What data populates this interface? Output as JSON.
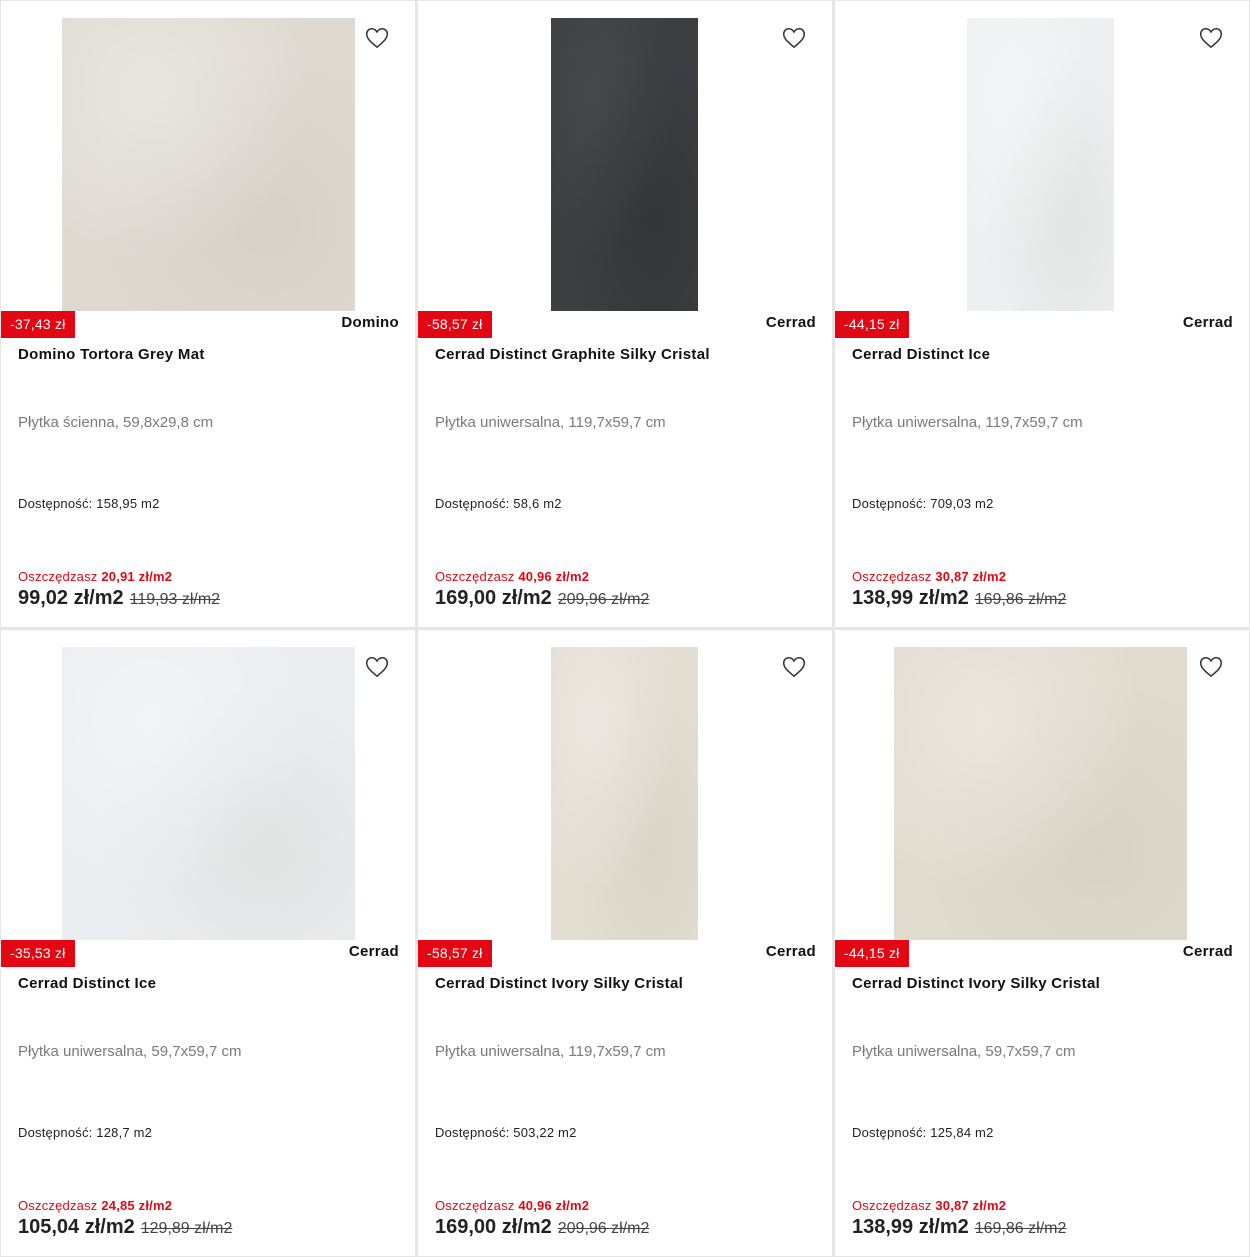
{
  "products": [
    {
      "badge": "-37,43 zł",
      "brand": "Domino",
      "name": "Domino Tortora Grey Mat",
      "description": "Płytka ścienna, 59,8x29,8 cm",
      "availability_label": "Dostępność:",
      "availability_value": "158,95 m2",
      "savings_label": "Oszczędzasz",
      "savings_value": "20,91 zł/m2",
      "price": "99,02 zł/m2",
      "old_price": "119,93 zł/m2",
      "tile_color": "#dedad2",
      "tile_shape": "square"
    },
    {
      "badge": "-58,57 zł",
      "brand": "Cerrad",
      "name": "Cerrad Distinct Graphite Silky Cristal",
      "description": "Płytka uniwersalna, 119,7x59,7 cm",
      "availability_label": "Dostępność:",
      "availability_value": "58,6 m2",
      "savings_label": "Oszczędzasz",
      "savings_value": "40,96 zł/m2",
      "price": "169,00 zł/m2",
      "old_price": "209,96 zł/m2",
      "tile_color": "#3b3f42",
      "tile_shape": "portrait"
    },
    {
      "badge": "-44,15 zł",
      "brand": "Cerrad",
      "name": "Cerrad Distinct Ice",
      "description": "Płytka uniwersalna, 119,7x59,7 cm",
      "availability_label": "Dostępność:",
      "availability_value": "709,03 m2",
      "savings_label": "Oszczędzasz",
      "savings_value": "30,87 zł/m2",
      "price": "138,99 zł/m2",
      "old_price": "169,86 zł/m2",
      "tile_color": "#edf0f1",
      "tile_shape": "portrait"
    },
    {
      "badge": "-35,53 zł",
      "brand": "Cerrad",
      "name": "Cerrad Distinct Ice",
      "description": "Płytka uniwersalna, 59,7x59,7 cm",
      "availability_label": "Dostępność:",
      "availability_value": "128,7 m2",
      "savings_label": "Oszczędzasz",
      "savings_value": "24,85 zł/m2",
      "price": "105,04 zł/m2",
      "old_price": "129,89 zł/m2",
      "tile_color": "#ebeef0",
      "tile_shape": "square"
    },
    {
      "badge": "-58,57 zł",
      "brand": "Cerrad",
      "name": "Cerrad Distinct Ivory Silky Cristal",
      "description": "Płytka uniwersalna, 119,7x59,7 cm",
      "availability_label": "Dostępność:",
      "availability_value": "503,22 m2",
      "savings_label": "Oszczędzasz",
      "savings_value": "40,96 zł/m2",
      "price": "169,00 zł/m2",
      "old_price": "209,96 zł/m2",
      "tile_color": "#e3ddd2",
      "tile_shape": "portrait"
    },
    {
      "badge": "-44,15 zł",
      "brand": "Cerrad",
      "name": "Cerrad Distinct Ivory Silky Cristal",
      "description": "Płytka uniwersalna, 59,7x59,7 cm",
      "availability_label": "Dostępność:",
      "availability_value": "125,84 m2",
      "savings_label": "Oszczędzasz",
      "savings_value": "30,87 zł/m2",
      "price": "138,99 zł/m2",
      "old_price": "169,86 zł/m2",
      "tile_color": "#e1dbcf",
      "tile_shape": "square"
    }
  ],
  "colors": {
    "accent": "#e30613",
    "heart_stroke": "#333333"
  },
  "icons": {
    "favorite": "heart-outline-icon"
  }
}
